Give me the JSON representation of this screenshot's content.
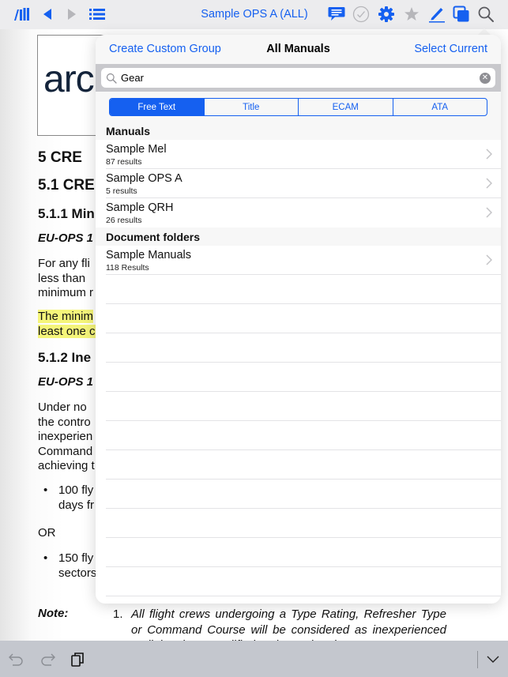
{
  "toolbar": {
    "title": "Sample OPS A (ALL)",
    "icons": [
      "library-icon",
      "back-arrow-icon",
      "forward-arrow-icon",
      "list-icon",
      "comment-icon",
      "check-circle-icon",
      "gear-icon",
      "star-icon",
      "pencil-icon",
      "copy-icon",
      "search-icon"
    ],
    "accent_color": "#1560f0"
  },
  "document": {
    "logo": "arc",
    "lines": [
      "5    CRE",
      "5.1 CRE",
      "5.1.1 Min",
      "EU-OPS 1",
      "For any fli",
      "less  than",
      "minimum r",
      "The minim",
      "least one c",
      "5.1.2 Ine",
      "EU-OPS 1",
      "Under no",
      "the  contro",
      "inexperien",
      "Command",
      "achieving t",
      "100  fly",
      "days fr",
      "OR",
      "150  fly",
      "sectors"
    ],
    "note_label": "Note:",
    "note_number": "1.",
    "note_text": "All flight crews undergoing a Type Rating, Refresher Type or Command Course will be considered as inexperienced until they have qualified and completed"
  },
  "popover": {
    "left_action": "Create Custom Group",
    "title": "All Manuals",
    "right_action": "Select Current",
    "search": {
      "value": "Gear",
      "placeholder": "Search"
    },
    "segments": [
      {
        "label": "Free Text",
        "active": true
      },
      {
        "label": "Title",
        "active": false
      },
      {
        "label": "ECAM",
        "active": false
      },
      {
        "label": "ATA",
        "active": false
      }
    ],
    "sections": [
      {
        "header": "Manuals",
        "rows": [
          {
            "name": "Sample Mel",
            "sub": "87 results"
          },
          {
            "name": "Sample OPS A",
            "sub": "5 results"
          },
          {
            "name": "Sample QRH",
            "sub": "26 results"
          }
        ]
      },
      {
        "header": "Document folders",
        "rows": [
          {
            "name": "Sample Manuals",
            "sub": "118 Results"
          }
        ]
      }
    ]
  },
  "bottombar": {
    "icons": [
      "undo-icon",
      "redo-icon",
      "paste-icon",
      "chevron-down-icon"
    ]
  }
}
